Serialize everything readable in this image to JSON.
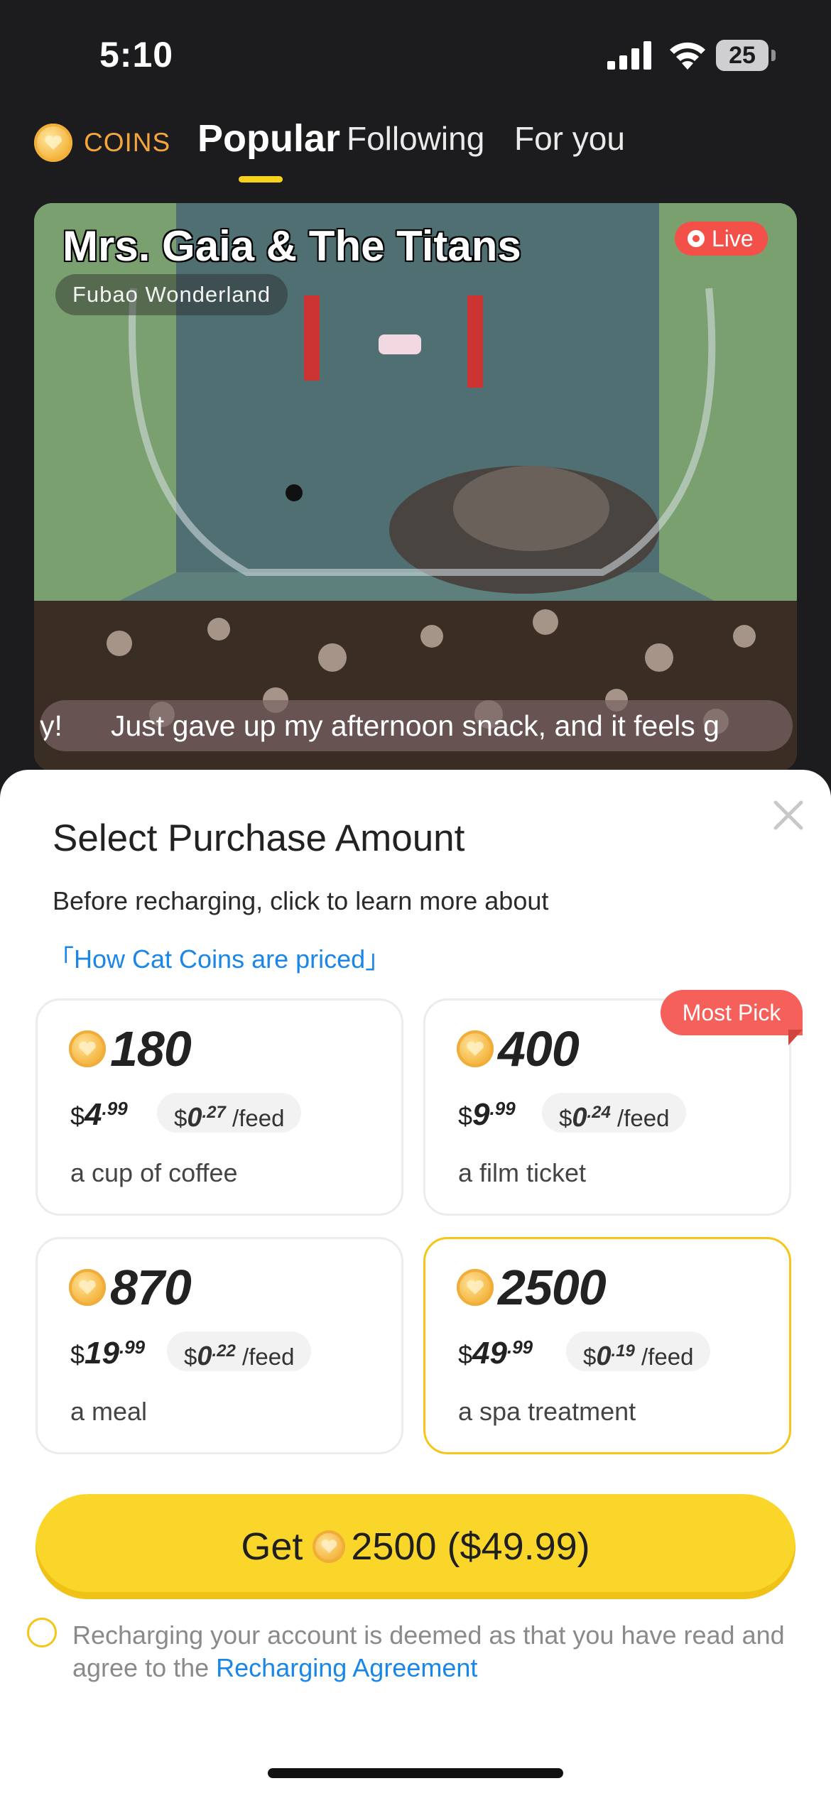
{
  "status_bar": {
    "time": "5:10",
    "battery": "25"
  },
  "nav": {
    "coins_label": "COINS",
    "tabs": [
      {
        "label": "Popular",
        "active": true
      },
      {
        "label": "Following"
      },
      {
        "label": "For you"
      }
    ]
  },
  "stream": {
    "title": "Mrs. Gaia & The Titans",
    "subtitle": "Fubao Wonderland",
    "live_label": "Live",
    "ticker_prefix": "y!",
    "ticker_text": "Just gave up my afternoon snack, and it feels g"
  },
  "sheet": {
    "title": "Select Purchase Amount",
    "description": "Before recharging, click to learn more about",
    "pricing_link": "「How Cat Coins are priced」",
    "most_pick_label": "Most Pick",
    "packages": [
      {
        "coins": "180",
        "price_dollar": "$",
        "price_int": "4",
        "price_cents": ".99",
        "feed_dollar": "$",
        "feed_int": "0",
        "feed_cents": ".27",
        "feed_unit": " /feed",
        "desc": "a cup of coffee",
        "selected": false
      },
      {
        "coins": "400",
        "price_dollar": "$",
        "price_int": "9",
        "price_cents": ".99",
        "feed_dollar": "$",
        "feed_int": "0",
        "feed_cents": ".24",
        "feed_unit": " /feed",
        "desc": "a film ticket",
        "selected": false
      },
      {
        "coins": "870",
        "price_dollar": "$",
        "price_int": "19",
        "price_cents": ".99",
        "feed_dollar": "$",
        "feed_int": "0",
        "feed_cents": ".22",
        "feed_unit": " /feed",
        "desc": "a meal",
        "selected": false
      },
      {
        "coins": "2500",
        "price_dollar": "$",
        "price_int": "49",
        "price_cents": ".99",
        "feed_dollar": "$",
        "feed_int": "0",
        "feed_cents": ".19",
        "feed_unit": " /feed",
        "desc": "a spa treatment",
        "selected": true
      }
    ],
    "cta_prefix": "Get",
    "cta_suffix": "2500 ($49.99)",
    "agreement_text": "Recharging your account is deemed as that you have read and agree to the ",
    "agreement_link": "Recharging Agreement"
  },
  "colors": {
    "accent_yellow": "#fbd62a",
    "live_red": "#f3504a",
    "link_blue": "#1a86e8",
    "coin_orange": "#f6a43c"
  }
}
